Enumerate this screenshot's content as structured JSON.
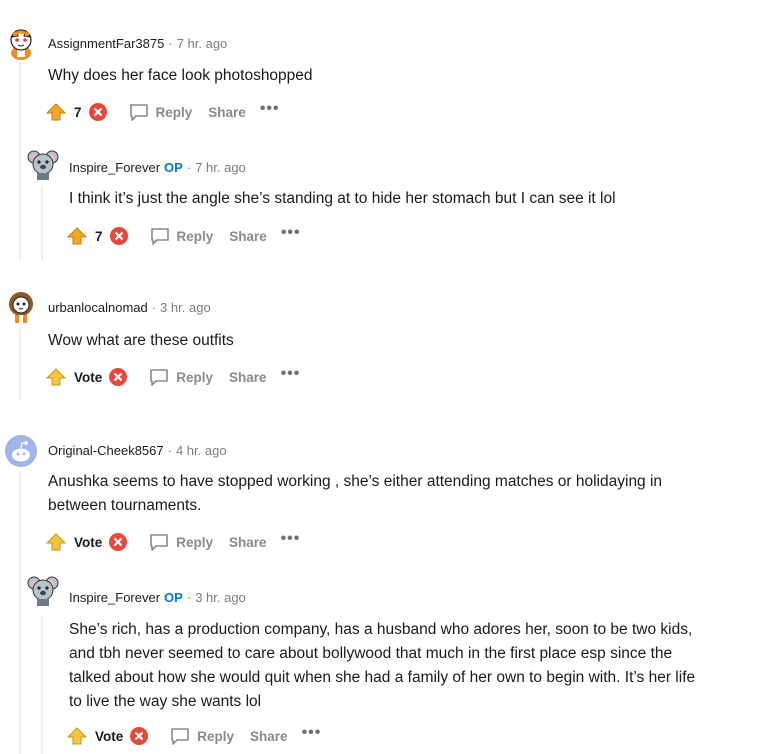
{
  "comments": [
    {
      "author": "AssignmentFar3875",
      "op": "",
      "time": "7 hr. ago",
      "text": "Why does her face look photoshopped",
      "votes": "7",
      "reply": "Reply",
      "share": "Share",
      "more": "•••"
    },
    {
      "author": "Inspire_Forever",
      "op": "OP",
      "time": "7 hr. ago",
      "text": "I think it’s just the angle she’s standing at to hide her stomach but I can see it lol",
      "votes": "7",
      "reply": "Reply",
      "share": "Share",
      "more": "•••"
    },
    {
      "author": "urbanlocalnomad",
      "op": "",
      "time": "3 hr. ago",
      "text": "Wow what are these outfits",
      "votes": "Vote",
      "reply": "Reply",
      "share": "Share",
      "more": "•••"
    },
    {
      "author": "Original-Cheek8567",
      "op": "",
      "time": "4 hr. ago",
      "text_lines": [
        "Anushka seems to have stopped working , she’s either attending matches or holidaying in",
        "between tournaments."
      ],
      "votes": "Vote",
      "reply": "Reply",
      "share": "Share",
      "more": "•••"
    },
    {
      "author": "Inspire_Forever",
      "op": "OP",
      "time": "3 hr. ago",
      "text_lines": [
        "She’s rich, has a production company, has a husband who adores her, soon to be two kids,",
        "and tbh never seemed to care about bollywood that much in the first place esp since the",
        "talked about how she would quit when she had a family of her own to begin with. It’s her life",
        "to live the way she wants lol"
      ],
      "votes": "Vote",
      "reply": "Reply",
      "share": "Share",
      "more": "•••"
    }
  ],
  "separator": "·",
  "colors": {
    "op": "#0079d3",
    "upvote": "#f5a623",
    "downvote": "#e8473b",
    "muted": "#878a8c",
    "thread": "#edeff1"
  },
  "icons": {
    "upvote": "upvote-arrow-icon",
    "downvote": "downvote-x-icon",
    "reply": "speech-bubble-icon",
    "more": "more-dots-icon"
  }
}
